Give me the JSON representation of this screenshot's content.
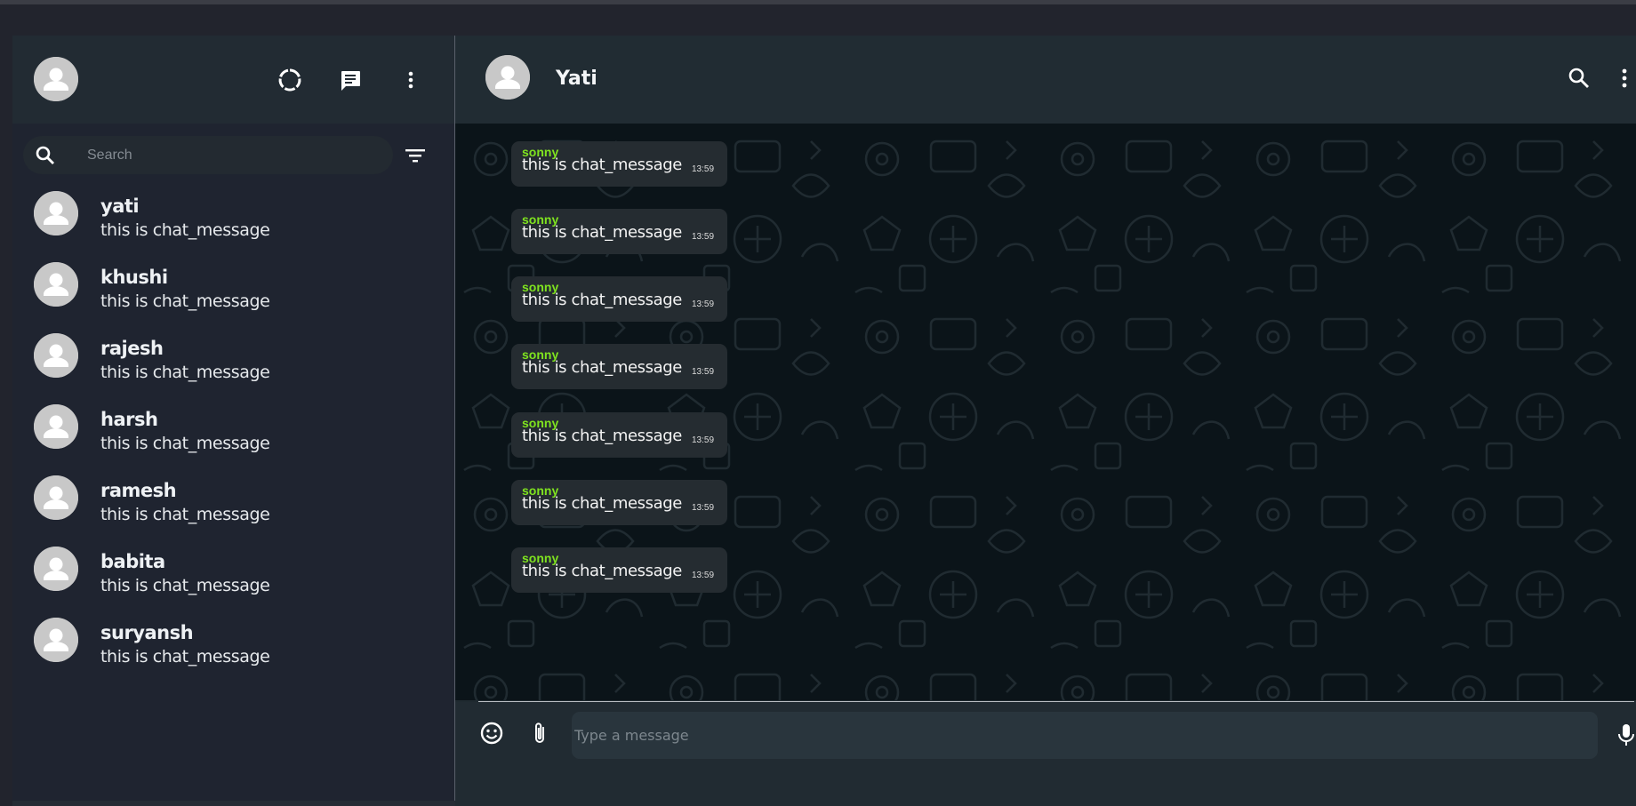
{
  "sidebar": {
    "header_icons": [
      "status-icon",
      "new-chat-icon",
      "menu-icon"
    ],
    "search": {
      "placeholder": "Search",
      "value": ""
    },
    "chats": [
      {
        "name": "yati",
        "last_message": "this is chat_message"
      },
      {
        "name": "khushi",
        "last_message": "this is chat_message"
      },
      {
        "name": "rajesh",
        "last_message": "this is chat_message"
      },
      {
        "name": "harsh",
        "last_message": "this is chat_message"
      },
      {
        "name": "ramesh",
        "last_message": "this is chat_message"
      },
      {
        "name": "babita",
        "last_message": "this is chat_message"
      },
      {
        "name": "suryansh",
        "last_message": "this is chat_message"
      }
    ]
  },
  "conversation": {
    "contact_name": "Yati",
    "messages": [
      {
        "sender": "sonny",
        "text": "this is chat_message",
        "time": "13:59"
      },
      {
        "sender": "sonny",
        "text": "this is chat_message",
        "time": "13:59"
      },
      {
        "sender": "sonny",
        "text": "this is chat_message",
        "time": "13:59"
      },
      {
        "sender": "sonny",
        "text": "this is chat_message",
        "time": "13:59"
      },
      {
        "sender": "sonny",
        "text": "this is chat_message",
        "time": "13:59"
      },
      {
        "sender": "sonny",
        "text": "this is chat_message",
        "time": "13:59"
      },
      {
        "sender": "sonny",
        "text": "this is chat_message",
        "time": "13:59"
      }
    ]
  },
  "composer": {
    "placeholder": "Type a message",
    "value": ""
  },
  "colors": {
    "sender_name": "#7fe31f",
    "sidebar_bg": "#1f2430",
    "chat_bg": "#0b1419",
    "bubble_bg": "#252c31"
  }
}
